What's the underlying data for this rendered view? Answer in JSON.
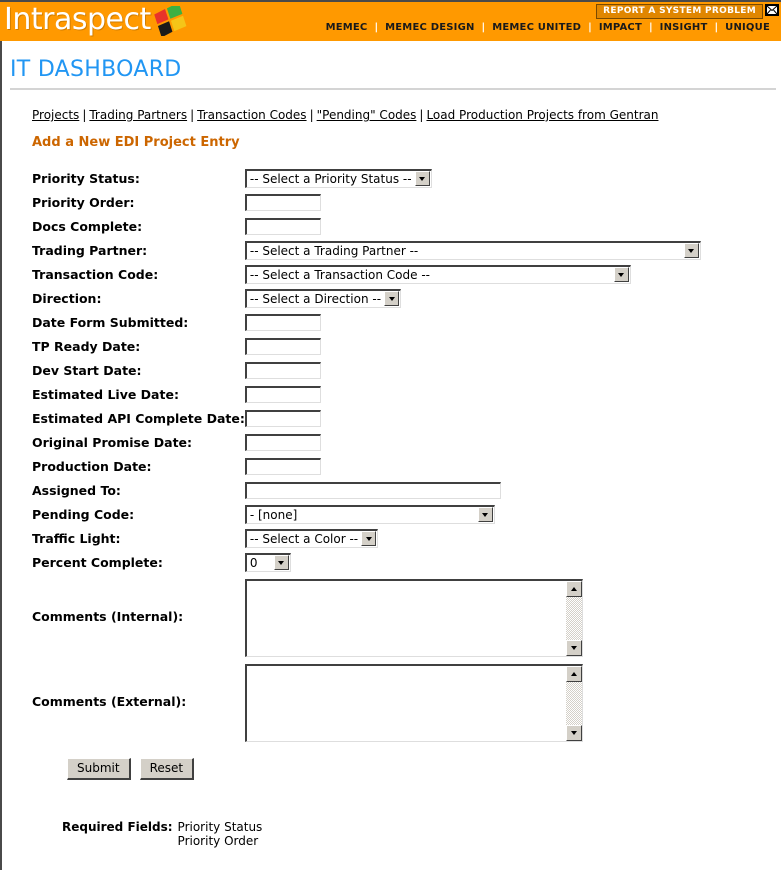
{
  "header": {
    "logo_text": "Intraspect",
    "logo_icon": "windows-flag-icon",
    "report_button_label": "REPORT A SYSTEM PROBLEM",
    "mail_icon": "envelope-icon",
    "bar_color": "#ff9900",
    "nav": [
      {
        "label": "MEMEC"
      },
      {
        "label": "MEMEC DESIGN"
      },
      {
        "label": "MEMEC UNITED"
      },
      {
        "label": "IMPACT"
      },
      {
        "label": "INSIGHT"
      },
      {
        "label": "UNIQUE"
      }
    ],
    "nav_separator": "|"
  },
  "page": {
    "title": "IT DASHBOARD",
    "title_color": "#2196f3",
    "subhead": "Add a New EDI Project Entry",
    "subhead_color": "#cc6600",
    "breadcrumb_separator": "|",
    "breadcrumbs": [
      {
        "label": "Projects"
      },
      {
        "label": "Trading Partners"
      },
      {
        "label": "Transaction Codes"
      },
      {
        "label": "\"Pending\" Codes"
      },
      {
        "label": "Load Production Projects from Gentran"
      }
    ]
  },
  "form": {
    "fields": {
      "priority_status": {
        "label": "Priority Status:",
        "type": "select",
        "value": "-- Select a Priority Status --"
      },
      "priority_order": {
        "label": "Priority Order:",
        "type": "text",
        "value": ""
      },
      "docs_complete": {
        "label": "Docs Complete:",
        "type": "text",
        "value": ""
      },
      "trading_partner": {
        "label": "Trading Partner:",
        "type": "select",
        "value": "-- Select a Trading Partner --"
      },
      "transaction_code": {
        "label": "Transaction Code:",
        "type": "select",
        "value": "-- Select a Transaction Code --"
      },
      "direction": {
        "label": "Direction:",
        "type": "select",
        "value": "-- Select a Direction --"
      },
      "date_form_submitted": {
        "label": "Date Form Submitted:",
        "type": "text",
        "value": ""
      },
      "tp_ready_date": {
        "label": "TP Ready Date:",
        "type": "text",
        "value": ""
      },
      "dev_start_date": {
        "label": "Dev Start Date:",
        "type": "text",
        "value": ""
      },
      "estimated_live_date": {
        "label": "Estimated Live Date:",
        "type": "text",
        "value": ""
      },
      "estimated_api_complete_date": {
        "label": "Estimated API Complete Date:",
        "type": "text",
        "value": ""
      },
      "original_promise_date": {
        "label": "Original Promise Date:",
        "type": "text",
        "value": ""
      },
      "production_date": {
        "label": "Production Date:",
        "type": "text",
        "value": ""
      },
      "assigned_to": {
        "label": "Assigned To:",
        "type": "text",
        "value": ""
      },
      "pending_code": {
        "label": "Pending Code:",
        "type": "select",
        "value": "- [none]"
      },
      "traffic_light": {
        "label": "Traffic Light:",
        "type": "select",
        "value": "-- Select a Color --"
      },
      "percent_complete": {
        "label": "Percent Complete:",
        "type": "select",
        "value": "0"
      },
      "comments_internal": {
        "label": "Comments (Internal):",
        "type": "textarea",
        "value": ""
      },
      "comments_external": {
        "label": "Comments (External):",
        "type": "textarea",
        "value": ""
      }
    },
    "submit_label": "Submit",
    "reset_label": "Reset"
  },
  "required": {
    "label": "Required Fields:",
    "items": [
      "Priority Status",
      "Priority Order"
    ]
  }
}
